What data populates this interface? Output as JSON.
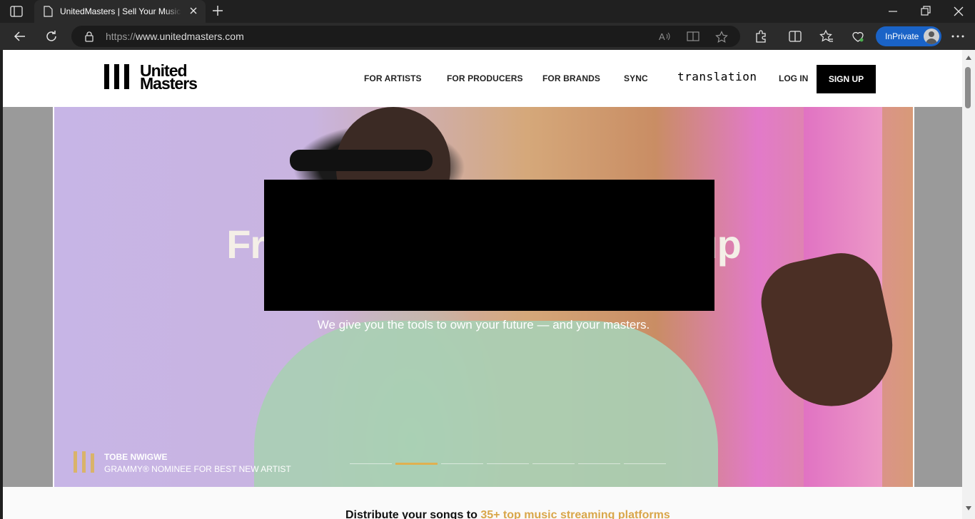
{
  "browser": {
    "tab_title": "UnitedMasters | Sell Your Music Onl",
    "url_prefix": "https://",
    "url_domain": "www.unitedmasters.com",
    "inprivate_label": "InPrivate",
    "icons": [
      "tab-actions-icon",
      "page-icon",
      "close-icon",
      "plus-icon",
      "minimize-icon",
      "restore-icon",
      "window-close-icon",
      "back-arrow-icon",
      "refresh-icon",
      "lock-icon",
      "read-aloud-icon",
      "immersive-reader-icon",
      "favorite-star-icon",
      "extensions-icon",
      "split-screen-icon",
      "favorites-icon",
      "browser-essentials-icon",
      "profile-avatar-icon",
      "more-dots-icon"
    ]
  },
  "site": {
    "logo_line1": "United",
    "logo_line2": "Masters",
    "nav": {
      "artists": "FOR ARTISTS",
      "producers": "FOR PRODUCERS",
      "brands": "FOR BRANDS",
      "sync": "SYNC",
      "translation": "translation"
    },
    "login": "LOG IN",
    "signup": "SIGN UP"
  },
  "hero": {
    "title_left": "Fre",
    "title_right": "up",
    "subtitle": "We give you the tools to own your future — and your masters.",
    "caption_name": "TOBE NWIGWE",
    "caption_desc": "GRAMMY® NOMINEE FOR BEST NEW ARTIST",
    "slides_total": 7,
    "slide_active": 2,
    "accent_color": "#e0b050"
  },
  "below_fold": {
    "text_plain": "Distribute your songs to ",
    "text_highlight": "35+ top music streaming platforms"
  }
}
